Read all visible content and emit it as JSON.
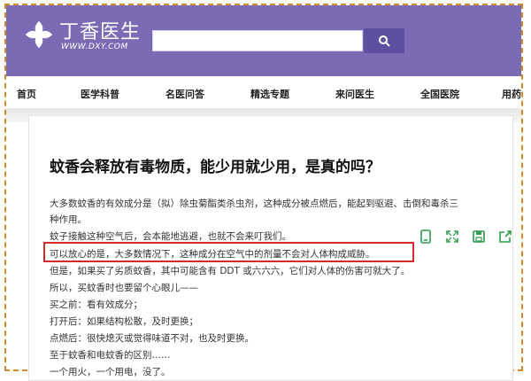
{
  "brand": {
    "name_cn": "丁香医生",
    "name_en": "WWW.DXY.COM",
    "color": "#7a6bb4"
  },
  "search": {
    "placeholder": "",
    "icon": "search-icon"
  },
  "nav": {
    "items": [
      "首页",
      "医学科普",
      "名医问答",
      "精选专题",
      "来问医生",
      "全国医院",
      "用药"
    ]
  },
  "article": {
    "title": "蚊香会释放有毒物质，能少用就少用，是真的吗？",
    "paragraphs": [
      "大多数蚊香的有效成分是（拟）除虫菊酯类杀虫剂，这种成分被点燃后，能起到驱避、击倒和毒杀三",
      "种作用。",
      "蚊子接触这种空气后，会本能地逃避，也就不会来叮我们。",
      "可以放心的是，大多数情况下，这种成分在空气中的剂量不会对人体构成威胁。",
      "但是，如果买了劣质蚊香，其中可能含有 DDT 或六六六，它们对人体的伤害可就大了。",
      "所以，买蚊香时也要留个心眼儿——",
      "买之前：看有效成分；",
      "打开后：如果结构松散，及时更换；",
      "点燃后：很快熄灭或觉得味道不对，也及时更换。",
      "至于蚊香和电蚊香的区别……",
      "一个用火，一个用电，没了。"
    ],
    "highlight_color": "#d42a2a"
  },
  "toolbar": {
    "icons": [
      "phone-icon",
      "expand-icon",
      "save-icon",
      "share-icon"
    ],
    "color": "#2e9b4f"
  }
}
